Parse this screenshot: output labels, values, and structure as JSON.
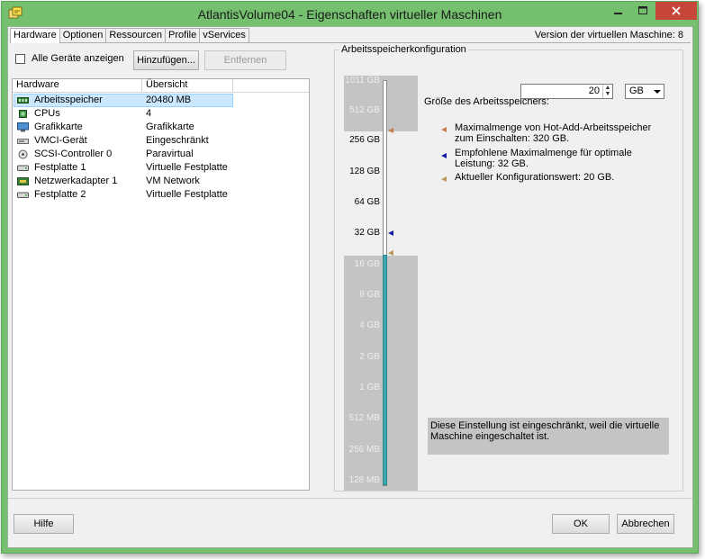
{
  "window": {
    "title": "AtlantisVolume04 - Eigenschaften virtueller Maschinen",
    "close_color": "#c7463b",
    "frame_color": "#74c06f"
  },
  "tabs": [
    {
      "label": "Hardware",
      "active": true
    },
    {
      "label": "Optionen"
    },
    {
      "label": "Ressourcen"
    },
    {
      "label": "Profile"
    },
    {
      "label": "vServices"
    }
  ],
  "vm_version": "Version der virtuellen Maschine: 8",
  "left": {
    "show_all_label": "Alle Geräte anzeigen",
    "show_all_checked": false,
    "add_label": "Hinzufügen...",
    "remove_label": "Entfernen",
    "columns": [
      "Hardware",
      "Übersicht"
    ],
    "rows": [
      {
        "icon": "memory-icon",
        "name": "Arbeitsspeicher",
        "summary": "20480 MB",
        "selected": true
      },
      {
        "icon": "cpu-icon",
        "name": "CPUs",
        "summary": "4"
      },
      {
        "icon": "display-icon",
        "name": "Grafikkarte",
        "summary": "Grafikkarte"
      },
      {
        "icon": "vmci-icon",
        "name": "VMCI-Gerät",
        "summary": "Eingeschränkt"
      },
      {
        "icon": "scsi-icon",
        "name": "SCSI-Controller 0",
        "summary": "Paravirtual"
      },
      {
        "icon": "disk-icon",
        "name": "Festplatte 1",
        "summary": "Virtuelle Festplatte"
      },
      {
        "icon": "network-icon",
        "name": "Netzwerkadapter 1",
        "summary": "VM Network"
      },
      {
        "icon": "disk-icon",
        "name": "Festplatte 2",
        "summary": "Virtuelle Festplatte"
      }
    ]
  },
  "memory": {
    "group_title": "Arbeitsspeicherkonfiguration",
    "size_label": "Größe des Arbeitsspeichers:",
    "value": "20",
    "unit": "GB",
    "scale_ticks": [
      "1011 GB",
      "512 GB",
      "256 GB",
      "128 GB",
      "64 GB",
      "32 GB",
      "16 GB",
      "8 GB",
      "4 GB",
      "2 GB",
      "1 GB",
      "512 MB",
      "256 MB",
      "128 MB"
    ],
    "legend": [
      {
        "color": "#c87d4d",
        "text": "Maximalmenge von Hot-Add-Arbeitsspeicher zum Einschalten: 320 GB."
      },
      {
        "color": "#1a1aa8",
        "text": "Empfohlene Maximalmenge für optimale Leistung: 32 GB."
      },
      {
        "color": "#b9965a",
        "text": "Aktueller Konfigurationswert: 20 GB."
      }
    ],
    "note": "Diese Einstellung ist eingeschränkt, weil die virtuelle Maschine eingeschaltet ist.",
    "fill_color": "#3aa8ae"
  },
  "footer": {
    "help_label": "Hilfe",
    "ok_label": "OK",
    "cancel_label": "Abbrechen"
  }
}
